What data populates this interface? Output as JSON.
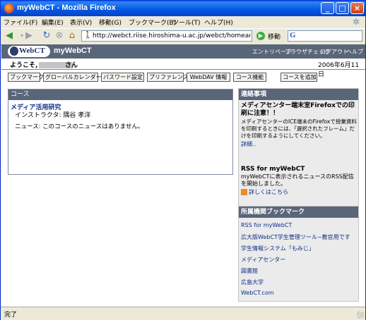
{
  "window": {
    "title": "myWebCT - Mozilla Firefox",
    "minimize": "_",
    "maximize": "□",
    "close": "×"
  },
  "menu": [
    "ファイル(F)",
    "編集(E)",
    "表示(V)",
    "移動(G)",
    "ブックマーク(B)",
    "ツール(T)",
    "ヘルプ(H)"
  ],
  "nav": {
    "url": "http://webct.riise.hiroshima-u.ac.jp/webct/homearea/h",
    "go_label": "移動",
    "search_logo": "G"
  },
  "webct": {
    "logo_text": "WebCT",
    "brand": "myWebCT",
    "header_links": [
      "エントリページ",
      "ブラウザチェック",
      "ログアウト",
      "ヘルプ"
    ],
    "greeting_prefix": "ようこそ,",
    "greeting_suffix": "さん",
    "date": "2006年6月11日",
    "toolbar_buttons": [
      "ブックマーク",
      "グローバルカレンダー",
      "パスワード設定",
      "プリファレンス",
      "WebDAV 情報",
      "コース機能",
      "コースを追加"
    ]
  },
  "course_panel": {
    "header": "コース",
    "course_name": "メディア活用研究",
    "instructor": "インストラクタ: 隅谷 孝洋",
    "news": "ニュース: このコースのニュースはありません。"
  },
  "notices": {
    "header": "連絡事項",
    "title": "メディアセンター端末室Firefoxでの印刷に注意！！",
    "body": "メディアセンターのICE端末のFirefoxで授業資料を印刷するときには、「選択されたフレーム」だけを印刷するようにしてください。",
    "more": "詳細..",
    "rss_title": "RSS for myWebCT",
    "rss_body": "myWebCTに表示されるニュースのRSS配信を開始しました。",
    "rss_more": "詳しくはこちら"
  },
  "bookmarks": {
    "header": "所属機関ブックマーク",
    "items": [
      "RSS for myWebCT",
      "広大版WebCT学生管理ツール−教官用です",
      "学生情報システム「もみじ」",
      "メディアセンター",
      "図書館",
      "広島大学",
      "WebCT.com"
    ]
  },
  "status": "完了",
  "colors": {
    "header_bg": "#596579",
    "link": "#0c2e8a",
    "titlebar": "#0758e1"
  }
}
